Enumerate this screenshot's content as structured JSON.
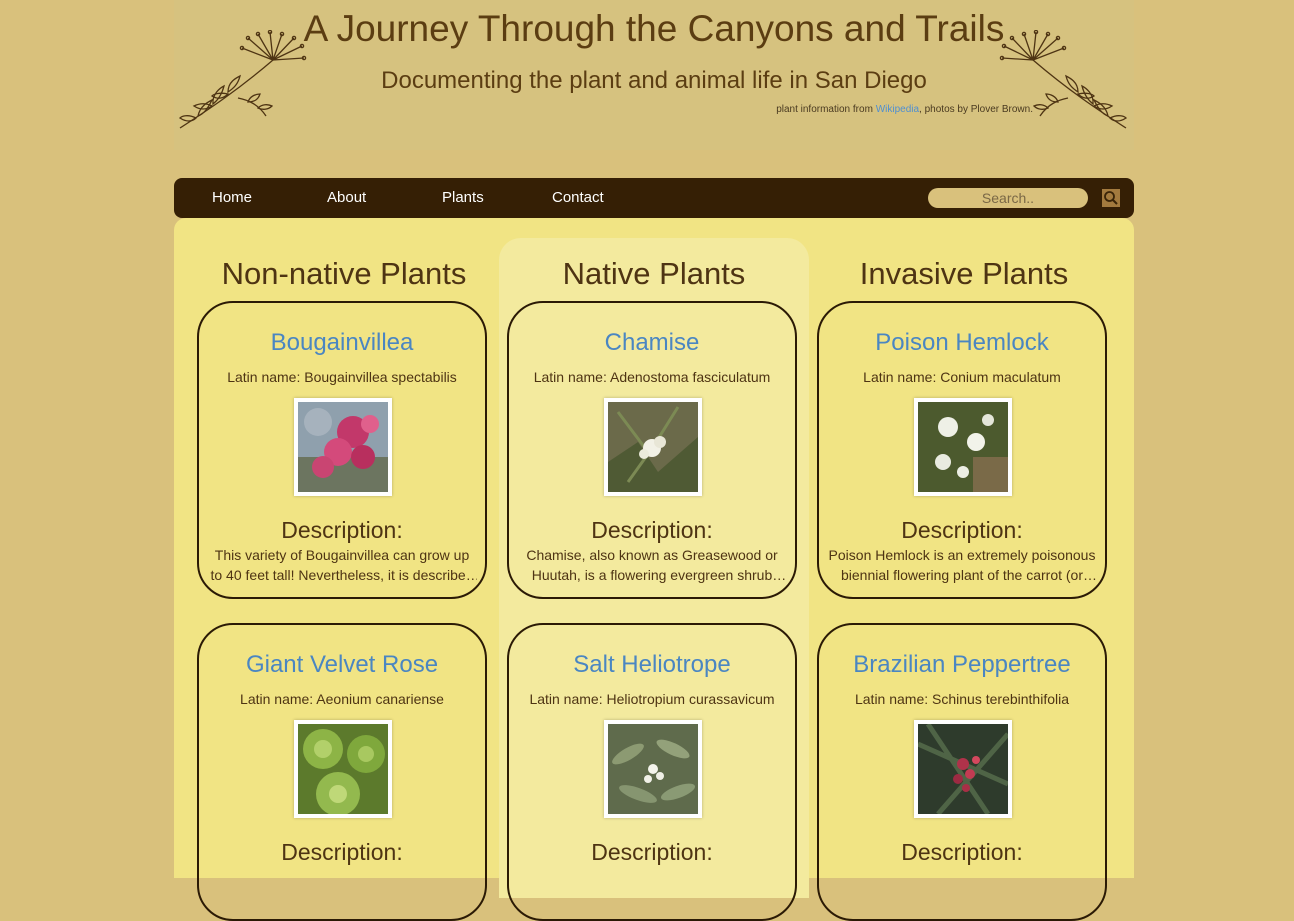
{
  "header": {
    "title": "A Journey Through the Canyons and Trails",
    "subtitle": "Documenting the plant and animal life in San Diego",
    "credit_prefix": "plant information from ",
    "credit_link": "Wikipedia",
    "credit_suffix": ", photos by Plover Brown."
  },
  "nav": {
    "items": [
      "Home",
      "About",
      "Plants",
      "Contact"
    ],
    "search_placeholder": "Search.."
  },
  "columns": [
    {
      "heading": "Non-native Plants",
      "cards": [
        {
          "name": "Bougainvillea",
          "latin": "Latin name: Bougainvillea spectabilis",
          "desc_heading": "Description:",
          "desc": "This variety of Bougainvillea can grow up to 40 feet tall! Nevertheless, it is described as a woody vine."
        },
        {
          "name": "Giant Velvet Rose",
          "latin": "Latin name: Aeonium canariense",
          "desc_heading": "Description:",
          "desc": ""
        }
      ]
    },
    {
      "heading": "Native Plants",
      "cards": [
        {
          "name": "Chamise",
          "latin": "Latin name: Adenostoma fasciculatum",
          "desc_heading": "Description:",
          "desc": "Chamise, also known as Greasewood or Huutah, is a flowering evergreen shrub native to California."
        },
        {
          "name": "Salt Heliotrope",
          "latin": "Latin name: Heliotropium curassavicum",
          "desc_heading": "Description:",
          "desc": ""
        }
      ]
    },
    {
      "heading": "Invasive Plants",
      "cards": [
        {
          "name": "Poison Hemlock",
          "latin": "Latin name: Conium maculatum",
          "desc_heading": "Description:",
          "desc": "Poison Hemlock is an extremely poisonous biennial flowering plant of the carrot (or parsley) family."
        },
        {
          "name": "Brazilian Peppertree",
          "latin": "Latin name: Schinus terebinthifolia",
          "desc_heading": "Description:",
          "desc": ""
        }
      ]
    }
  ],
  "colors": {
    "page_bg": "#d9c17c",
    "nav_bg": "#351f05",
    "panel_bg": "#f1e484",
    "native_bg": "#f3ea9e",
    "link_blue": "#4a86c2"
  }
}
